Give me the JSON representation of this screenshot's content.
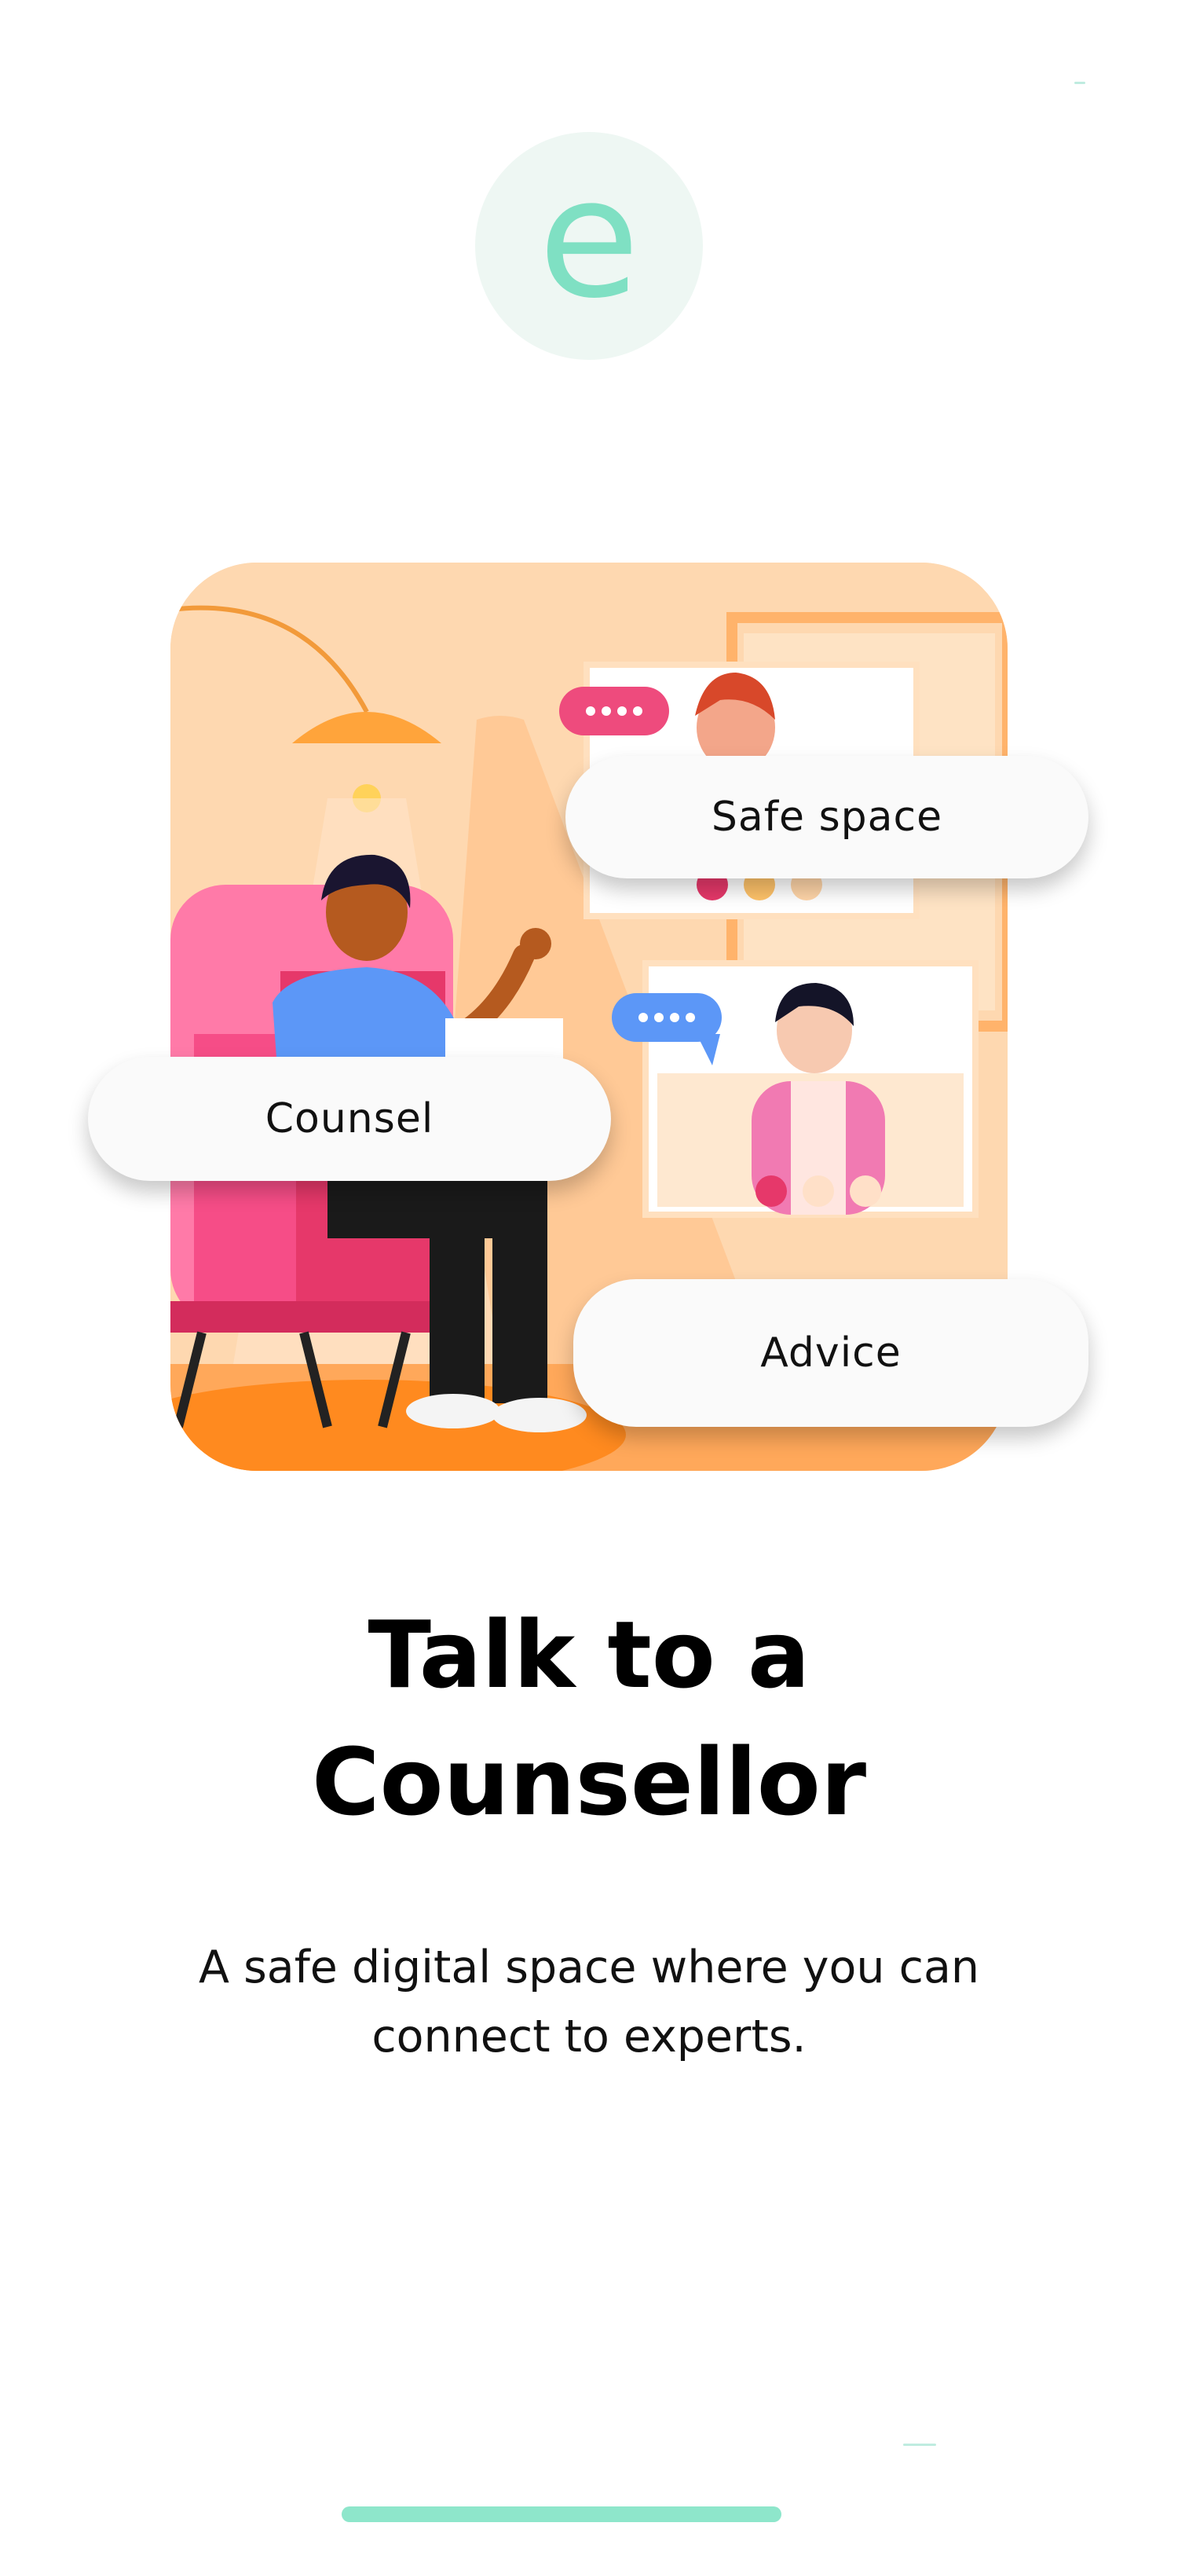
{
  "brand": {
    "logo_letter": "e",
    "accent_color": "#7fe0c3",
    "logo_bg": "#eef7f3"
  },
  "illustration": {
    "description_icon": "counselling-video-call-illustration",
    "tags": [
      "Safe space",
      "Counsel",
      "Advice"
    ]
  },
  "onboarding": {
    "title_line1": "Talk to a",
    "title_line2": "Counsellor",
    "subtitle_line1": "A safe digital space where you can",
    "subtitle_line2": "connect to experts."
  },
  "colors": {
    "home_indicator": "#8ee6cb",
    "illustration_bg": "#fed8b0"
  }
}
